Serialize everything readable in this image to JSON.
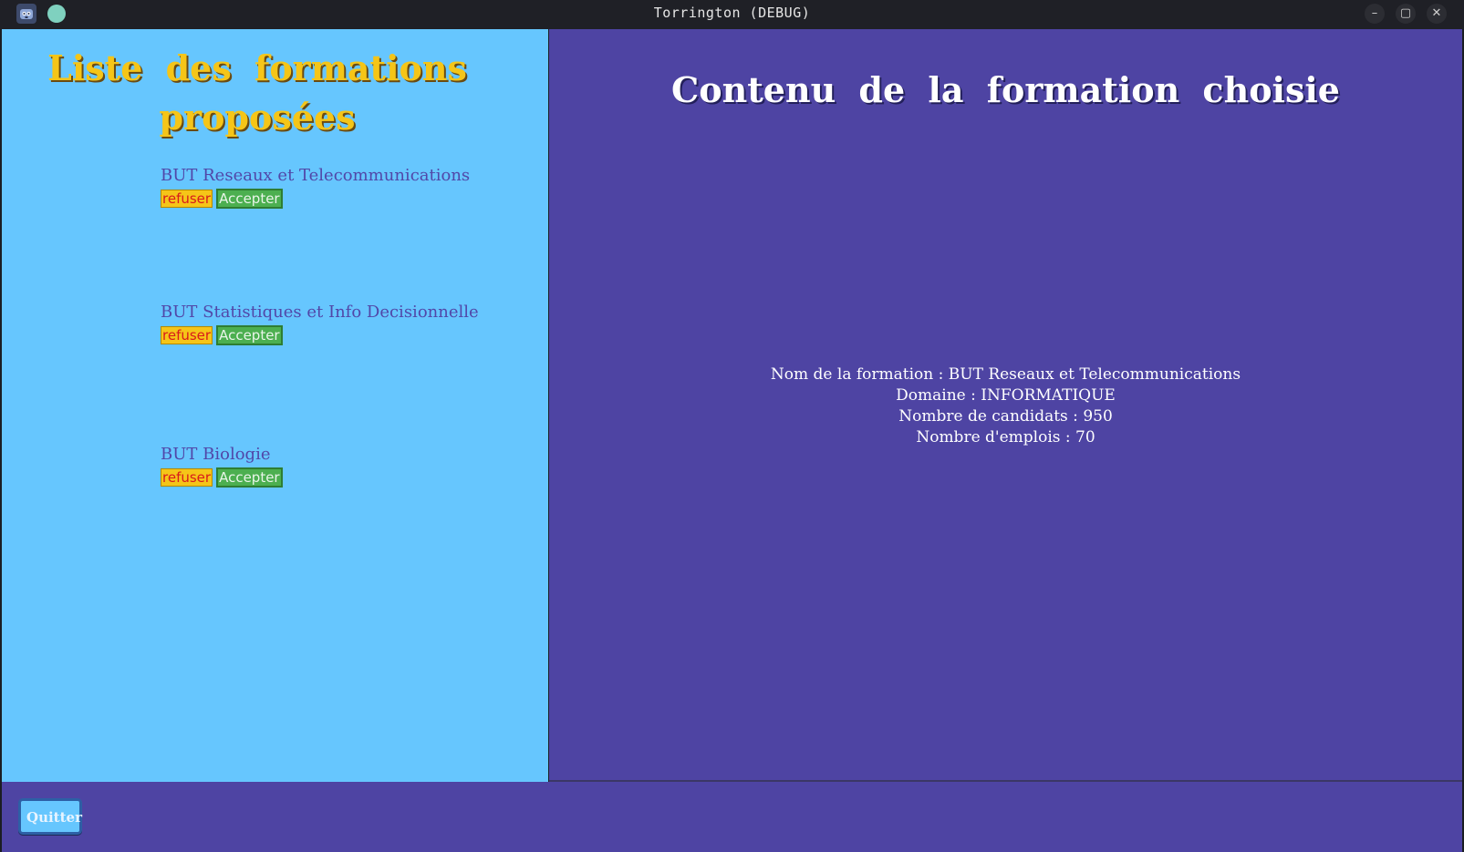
{
  "window": {
    "title": "Torrington (DEBUG)",
    "minimize_glyph": "–",
    "maximize_glyph": "▢",
    "close_glyph": "✕"
  },
  "left": {
    "title": "Liste des formations proposées",
    "formations": [
      {
        "name": "BUT Reseaux et Telecommunications",
        "refuse_label": "refuser",
        "accept_label": "Accepter"
      },
      {
        "name": "BUT Statistiques et Info Decisionnelle",
        "refuse_label": "refuser",
        "accept_label": "Accepter"
      },
      {
        "name": "BUT Biologie",
        "refuse_label": "refuser",
        "accept_label": "Accepter"
      }
    ]
  },
  "right": {
    "title": "Contenu de la formation choisie",
    "details": [
      "Nom de la formation : BUT Reseaux et Telecommunications",
      "Domaine : INFORMATIQUE",
      "Nombre de candidats : 950",
      "Nombre d'emplois : 70"
    ]
  },
  "footer": {
    "quit_label": "Quitter"
  },
  "colors": {
    "left_panel": "#66c6fe",
    "right_panel": "#4e44a3",
    "title_gold": "#f5c518",
    "refuse_bg": "#f5c518",
    "refuse_text": "#d81b1b",
    "accept_bg": "#4caf50"
  },
  "icons": {
    "app": "godot-logo-icon",
    "status": "status-dot-icon"
  }
}
